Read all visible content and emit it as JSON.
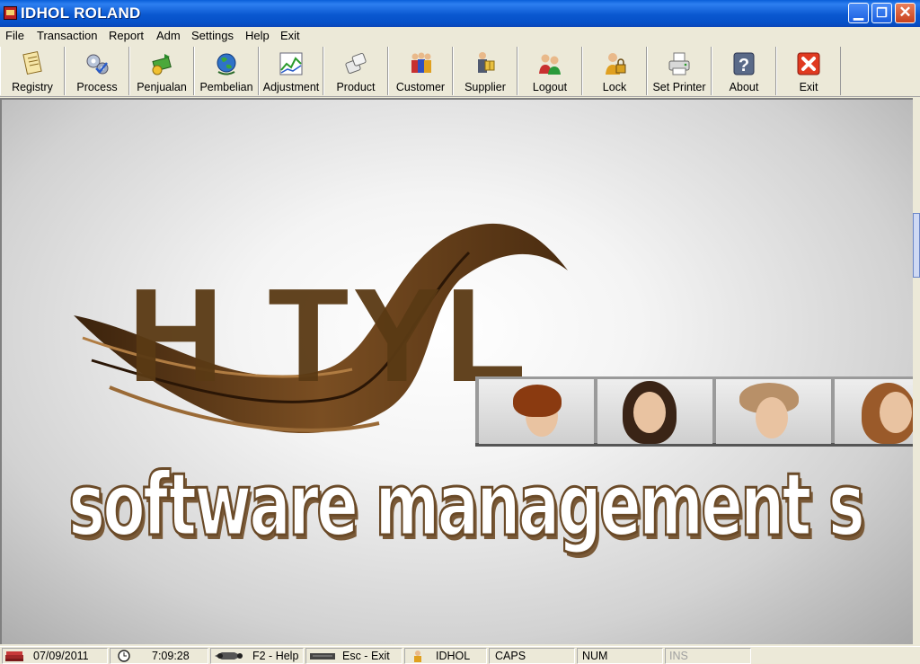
{
  "window": {
    "title": "IDHOL ROLAND",
    "min_glyph": "▁",
    "max_glyph": "❐",
    "close_glyph": "✕"
  },
  "menu": [
    "File",
    "Transaction",
    "Report",
    "Adm",
    "Settings",
    "Help",
    "Exit"
  ],
  "toolbar": [
    {
      "label": "Registry",
      "icon": "registry-icon"
    },
    {
      "label": "Process",
      "icon": "gears-icon"
    },
    {
      "label": "Penjualan",
      "icon": "money-icon"
    },
    {
      "label": "Pembelian",
      "icon": "globe-icon"
    },
    {
      "label": "Adjustment",
      "icon": "chart-icon"
    },
    {
      "label": "Product",
      "icon": "product-icon"
    },
    {
      "label": "Customer",
      "icon": "customer-icon"
    },
    {
      "label": "Supplier",
      "icon": "supplier-icon"
    },
    {
      "label": "Logout",
      "icon": "users-icon"
    },
    {
      "label": "Lock",
      "icon": "lock-icon"
    },
    {
      "label": "Set Printer",
      "icon": "printer-icon"
    },
    {
      "label": "About",
      "icon": "question-icon"
    },
    {
      "label": "Exit",
      "icon": "exit-icon"
    }
  ],
  "banner": {
    "big_text": "H TYL",
    "tagline": "software management s"
  },
  "status": {
    "date": "07/09/2011",
    "time": "7:09:28",
    "help": "F2 - Help",
    "exit": "Esc - Exit",
    "user": "IDHOL",
    "caps": "CAPS",
    "num": "NUM",
    "ins": "INS"
  },
  "colors": {
    "titlebar": "#0a58d0",
    "hair": "#5a3a14",
    "close": "#c8401c"
  }
}
